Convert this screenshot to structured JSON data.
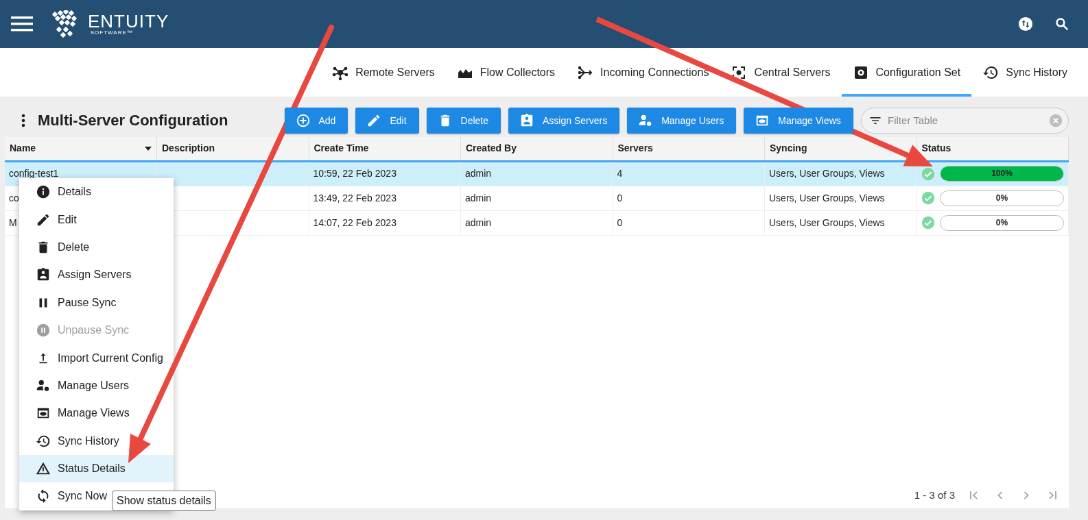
{
  "header": {
    "logo": {
      "name": "ENTUITY",
      "tagline": "SOFTWARE™"
    }
  },
  "tabs": [
    {
      "label": "Remote Servers",
      "selected": false
    },
    {
      "label": "Flow Collectors",
      "selected": false
    },
    {
      "label": "Incoming Connections",
      "selected": false
    },
    {
      "label": "Central Servers",
      "selected": false
    },
    {
      "label": "Configuration Set",
      "selected": true
    },
    {
      "label": "Sync History",
      "selected": false
    }
  ],
  "page": {
    "title": "Multi-Server Configuration"
  },
  "toolbar": {
    "buttons": [
      "Add",
      "Edit",
      "Delete",
      "Assign Servers",
      "Manage Users",
      "Manage Views"
    ],
    "filter": {
      "placeholder": "Filter Table"
    }
  },
  "table": {
    "columns": [
      {
        "label": "Name",
        "sorted": true
      },
      {
        "label": "Description",
        "sorted": false
      },
      {
        "label": "Create Time",
        "sorted": false
      },
      {
        "label": "Created By",
        "sorted": false
      },
      {
        "label": "Servers",
        "sorted": false
      },
      {
        "label": "Syncing",
        "sorted": false
      },
      {
        "label": "Status",
        "sorted": false
      }
    ],
    "rows": [
      {
        "selected": true,
        "name": "config-test1",
        "create_time": "10:59, 22 Feb 2023",
        "created_by": "admin",
        "servers": "4",
        "syncing": "Users, User Groups, Views",
        "status": {
          "level": 1,
          "reading": "100%"
        }
      },
      {
        "selected": false,
        "name": "co",
        "create_time": "13:49, 22 Feb 2023",
        "created_by": "admin",
        "servers": "0",
        "syncing": "Users, User Groups, Views",
        "status": {
          "level": 0,
          "reading": "0%"
        }
      },
      {
        "selected": false,
        "name": "M",
        "create_time": "14:07, 22 Feb 2023",
        "created_by": "admin",
        "servers": "0",
        "syncing": "Users, User Groups, Views",
        "status": {
          "level": 0,
          "reading": "0%"
        }
      }
    ]
  },
  "pagination": {
    "range": "1 - 3 of 3"
  },
  "context_menu": {
    "items": [
      {
        "label": "Details",
        "selected": false,
        "disabled": false
      },
      {
        "label": "Edit",
        "selected": false,
        "disabled": false
      },
      {
        "label": "Delete",
        "selected": false,
        "disabled": false
      },
      {
        "label": "Assign Servers",
        "selected": false,
        "disabled": false
      },
      {
        "label": "Pause Sync",
        "selected": false,
        "disabled": false
      },
      {
        "label": "Unpause Sync",
        "selected": false,
        "disabled": true
      },
      {
        "label": "Import Current Config",
        "selected": false,
        "disabled": false
      },
      {
        "label": "Manage Users",
        "selected": false,
        "disabled": false
      },
      {
        "label": "Manage Views",
        "selected": false,
        "disabled": false
      },
      {
        "label": "Sync History",
        "selected": false,
        "disabled": false
      },
      {
        "label": "Status Details",
        "selected": true,
        "disabled": false
      },
      {
        "label": "Sync Now",
        "selected": false,
        "disabled": false
      }
    ]
  },
  "tooltip": {
    "text": "Show status details"
  }
}
